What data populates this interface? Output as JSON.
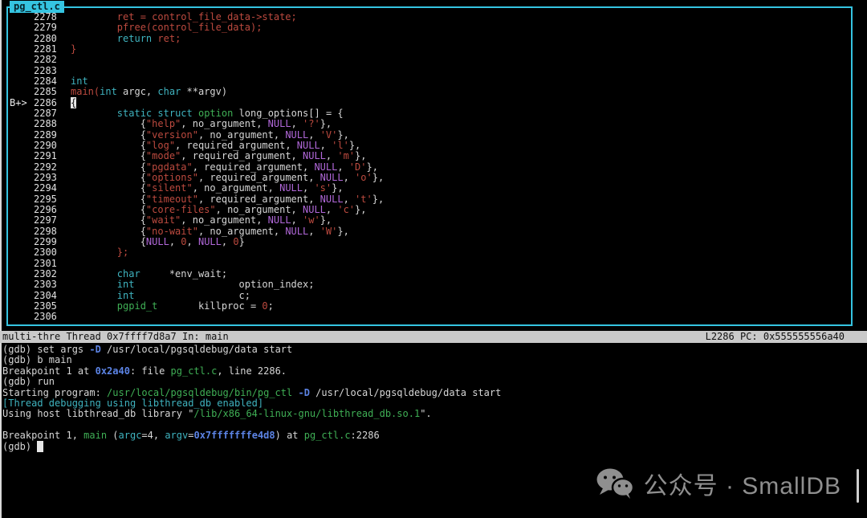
{
  "colors": {
    "tui_border": "#35c4e1",
    "status_bg": "#c9c9c9",
    "keyword": "#3fb3bf",
    "usertype": "#3faf55",
    "string": "#bd4a3f",
    "null_literal": "#b168d9",
    "address": "#5c84e6",
    "watermark": "#8f8f8f"
  },
  "source": {
    "title": "pg_ctl.c",
    "lines": [
      {
        "n": "2278",
        "m": "",
        "segs": [
          [
            "        ",
            "w"
          ],
          [
            "ret = control_file_data->state;",
            "r"
          ]
        ]
      },
      {
        "n": "2279",
        "m": "",
        "segs": [
          [
            "        ",
            "w"
          ],
          [
            "pfree(control_file_data);",
            "r"
          ]
        ]
      },
      {
        "n": "2280",
        "m": "",
        "segs": [
          [
            "        ",
            "w"
          ],
          [
            "return",
            "k"
          ],
          [
            " ",
            "w"
          ],
          [
            "ret;",
            "r"
          ]
        ]
      },
      {
        "n": "2281",
        "m": "",
        "segs": [
          [
            "}",
            "r"
          ]
        ]
      },
      {
        "n": "2282",
        "m": "",
        "segs": []
      },
      {
        "n": "2283",
        "m": "",
        "segs": []
      },
      {
        "n": "2284",
        "m": "",
        "segs": [
          [
            "int",
            "k"
          ]
        ]
      },
      {
        "n": "2285",
        "m": "",
        "segs": [
          [
            "main(",
            "r"
          ],
          [
            "int",
            "k"
          ],
          [
            " argc, ",
            "w"
          ],
          [
            "char",
            "k"
          ],
          [
            " **argv)",
            "w"
          ]
        ]
      },
      {
        "n": "2286",
        "m": "B+>",
        "segs": [
          [
            "{",
            "cur"
          ]
        ]
      },
      {
        "n": "2287",
        "m": "",
        "segs": [
          [
            "        ",
            "w"
          ],
          [
            "static",
            "k"
          ],
          [
            " ",
            "w"
          ],
          [
            "struct",
            "k"
          ],
          [
            " ",
            "w"
          ],
          [
            "option",
            "g"
          ],
          [
            " long_options[] = {",
            "w"
          ]
        ]
      },
      {
        "n": "2288",
        "m": "",
        "segs": [
          [
            "            {",
            "w"
          ],
          [
            "\"help\"",
            "r"
          ],
          [
            ", no_argument, ",
            "w"
          ],
          [
            "NULL",
            "m"
          ],
          [
            ", ",
            "w"
          ],
          [
            "'?'",
            "r"
          ],
          [
            "},",
            "w"
          ]
        ]
      },
      {
        "n": "2289",
        "m": "",
        "segs": [
          [
            "            {",
            "w"
          ],
          [
            "\"version\"",
            "r"
          ],
          [
            ", no_argument, ",
            "w"
          ],
          [
            "NULL",
            "m"
          ],
          [
            ", ",
            "w"
          ],
          [
            "'V'",
            "r"
          ],
          [
            "},",
            "w"
          ]
        ]
      },
      {
        "n": "2290",
        "m": "",
        "segs": [
          [
            "            {",
            "w"
          ],
          [
            "\"log\"",
            "r"
          ],
          [
            ", required_argument, ",
            "w"
          ],
          [
            "NULL",
            "m"
          ],
          [
            ", ",
            "w"
          ],
          [
            "'l'",
            "r"
          ],
          [
            "},",
            "w"
          ]
        ]
      },
      {
        "n": "2291",
        "m": "",
        "segs": [
          [
            "            {",
            "w"
          ],
          [
            "\"mode\"",
            "r"
          ],
          [
            ", required_argument, ",
            "w"
          ],
          [
            "NULL",
            "m"
          ],
          [
            ", ",
            "w"
          ],
          [
            "'m'",
            "r"
          ],
          [
            "},",
            "w"
          ]
        ]
      },
      {
        "n": "2292",
        "m": "",
        "segs": [
          [
            "            {",
            "w"
          ],
          [
            "\"pgdata\"",
            "r"
          ],
          [
            ", required_argument, ",
            "w"
          ],
          [
            "NULL",
            "m"
          ],
          [
            ", ",
            "w"
          ],
          [
            "'D'",
            "r"
          ],
          [
            "},",
            "w"
          ]
        ]
      },
      {
        "n": "2293",
        "m": "",
        "segs": [
          [
            "            {",
            "w"
          ],
          [
            "\"options\"",
            "r"
          ],
          [
            ", required_argument, ",
            "w"
          ],
          [
            "NULL",
            "m"
          ],
          [
            ", ",
            "w"
          ],
          [
            "'o'",
            "r"
          ],
          [
            "},",
            "w"
          ]
        ]
      },
      {
        "n": "2294",
        "m": "",
        "segs": [
          [
            "            {",
            "w"
          ],
          [
            "\"silent\"",
            "r"
          ],
          [
            ", no_argument, ",
            "w"
          ],
          [
            "NULL",
            "m"
          ],
          [
            ", ",
            "w"
          ],
          [
            "'s'",
            "r"
          ],
          [
            "},",
            "w"
          ]
        ]
      },
      {
        "n": "2295",
        "m": "",
        "segs": [
          [
            "            {",
            "w"
          ],
          [
            "\"timeout\"",
            "r"
          ],
          [
            ", required_argument, ",
            "w"
          ],
          [
            "NULL",
            "m"
          ],
          [
            ", ",
            "w"
          ],
          [
            "'t'",
            "r"
          ],
          [
            "},",
            "w"
          ]
        ]
      },
      {
        "n": "2296",
        "m": "",
        "segs": [
          [
            "            {",
            "w"
          ],
          [
            "\"core-files\"",
            "r"
          ],
          [
            ", no_argument, ",
            "w"
          ],
          [
            "NULL",
            "m"
          ],
          [
            ", ",
            "w"
          ],
          [
            "'c'",
            "r"
          ],
          [
            "},",
            "w"
          ]
        ]
      },
      {
        "n": "2297",
        "m": "",
        "segs": [
          [
            "            {",
            "w"
          ],
          [
            "\"wait\"",
            "r"
          ],
          [
            ", no_argument, ",
            "w"
          ],
          [
            "NULL",
            "m"
          ],
          [
            ", ",
            "w"
          ],
          [
            "'w'",
            "r"
          ],
          [
            "},",
            "w"
          ]
        ]
      },
      {
        "n": "2298",
        "m": "",
        "segs": [
          [
            "            {",
            "w"
          ],
          [
            "\"no-wait\"",
            "r"
          ],
          [
            ", no_argument, ",
            "w"
          ],
          [
            "NULL",
            "m"
          ],
          [
            ", ",
            "w"
          ],
          [
            "'W'",
            "r"
          ],
          [
            "},",
            "w"
          ]
        ]
      },
      {
        "n": "2299",
        "m": "",
        "segs": [
          [
            "            {",
            "w"
          ],
          [
            "NULL",
            "m"
          ],
          [
            ", ",
            "w"
          ],
          [
            "0",
            "r"
          ],
          [
            ", ",
            "w"
          ],
          [
            "NULL",
            "m"
          ],
          [
            ", ",
            "w"
          ],
          [
            "0",
            "r"
          ],
          [
            "}",
            "w"
          ]
        ]
      },
      {
        "n": "2300",
        "m": "",
        "segs": [
          [
            "        ",
            "w"
          ],
          [
            "};",
            "r"
          ]
        ]
      },
      {
        "n": "2301",
        "m": "",
        "segs": []
      },
      {
        "n": "2302",
        "m": "",
        "segs": [
          [
            "        ",
            "w"
          ],
          [
            "char",
            "k"
          ],
          [
            "     *env_wait;",
            "w"
          ]
        ]
      },
      {
        "n": "2303",
        "m": "",
        "segs": [
          [
            "        ",
            "w"
          ],
          [
            "int",
            "k"
          ],
          [
            "                  option_index;",
            "w"
          ]
        ]
      },
      {
        "n": "2304",
        "m": "",
        "segs": [
          [
            "        ",
            "w"
          ],
          [
            "int",
            "k"
          ],
          [
            "                  c;",
            "w"
          ]
        ]
      },
      {
        "n": "2305",
        "m": "",
        "segs": [
          [
            "        ",
            "w"
          ],
          [
            "pgpid_t",
            "g"
          ],
          [
            "       killproc = ",
            "w"
          ],
          [
            "0",
            "r"
          ],
          [
            ";",
            "w"
          ]
        ]
      },
      {
        "n": "2306",
        "m": "",
        "segs": []
      }
    ]
  },
  "status_bar": {
    "left": "multi-thre Thread 0x7ffff7d8a7 In: main",
    "right": "L2286 PC: 0x555555556a40"
  },
  "console": {
    "lines": [
      [
        [
          "(gdb) set args ",
          "w"
        ],
        [
          "-D",
          "b"
        ],
        [
          " /usr/local/pgsqldebug/data start",
          "w"
        ]
      ],
      [
        [
          "(gdb) b main",
          "w"
        ]
      ],
      [
        [
          "Breakpoint 1 at ",
          "w"
        ],
        [
          "0x2a40",
          "b"
        ],
        [
          ": file ",
          "w"
        ],
        [
          "pg_ctl.c",
          "g"
        ],
        [
          ", line 2286.",
          "w"
        ]
      ],
      [
        [
          "(gdb) run",
          "w"
        ]
      ],
      [
        [
          "Starting program: ",
          "w"
        ],
        [
          "/usr/local/pgsqldebug/bin/pg_ctl",
          "g"
        ],
        [
          " ",
          "w"
        ],
        [
          "-D",
          "b"
        ],
        [
          " /usr/local/pgsqldebug/data start",
          "w"
        ]
      ],
      [
        [
          "[Thread debugging using libthread_db enabled]",
          "t"
        ]
      ],
      [
        [
          "Using host libthread_db library \"",
          "w"
        ],
        [
          "/lib/x86_64-linux-gnu/libthread_db.so.1",
          "g"
        ],
        [
          "\".",
          "w"
        ]
      ],
      [],
      [
        [
          "Breakpoint 1, ",
          "w"
        ],
        [
          "main",
          "g"
        ],
        [
          " (",
          "w"
        ],
        [
          "argc",
          "k"
        ],
        [
          "=4, ",
          "w"
        ],
        [
          "argv",
          "k"
        ],
        [
          "=",
          "w"
        ],
        [
          "0x7fffffffe4d8",
          "b"
        ],
        [
          ") at ",
          "w"
        ],
        [
          "pg_ctl.c",
          "g"
        ],
        [
          ":2286",
          "w"
        ]
      ],
      [
        [
          "(gdb) ",
          "w"
        ],
        [
          " ",
          "cur"
        ]
      ]
    ]
  },
  "watermark": {
    "text": "公众号 · SmallDB",
    "icon": "wechat-icon"
  }
}
